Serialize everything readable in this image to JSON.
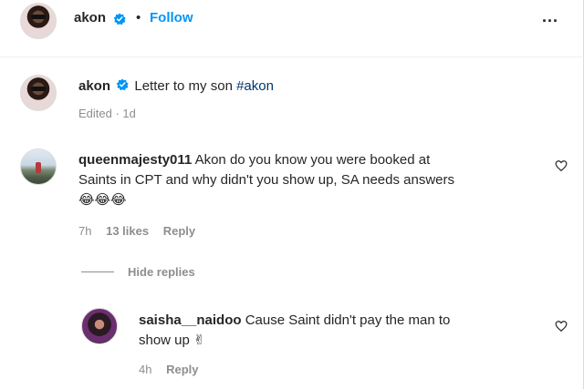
{
  "header": {
    "username": "akon",
    "separator": "•",
    "follow_label": "Follow",
    "more_label": "..."
  },
  "caption": {
    "username": "akon",
    "text": "Letter to my son ",
    "hashtag": "#akon",
    "meta": "Edited · 1d"
  },
  "comments": [
    {
      "username": "queenmajesty011",
      "text_line1": " Akon do you know you were booked at",
      "text_line2": "Saints in CPT and why didn't you show up, SA needs answers",
      "text_line3": "😂😂😂",
      "time": "7h",
      "likes": "13 likes",
      "reply_label": "Reply"
    }
  ],
  "hide_replies_label": "Hide replies",
  "replies": [
    {
      "username": "saisha__naidoo",
      "text_line1": " Cause Saint didn't pay the man to",
      "text_line2": "show up ✌",
      "time": "4h",
      "reply_label": "Reply"
    }
  ],
  "colors": {
    "accent": "#0095f6",
    "text": "#262626",
    "muted": "#8e8e8e",
    "hashtag": "#00376b",
    "verified": "#0095f6"
  },
  "icons": {
    "verified": "verified-badge-icon",
    "heart": "heart-outline-icon",
    "more": "more-options-icon"
  }
}
